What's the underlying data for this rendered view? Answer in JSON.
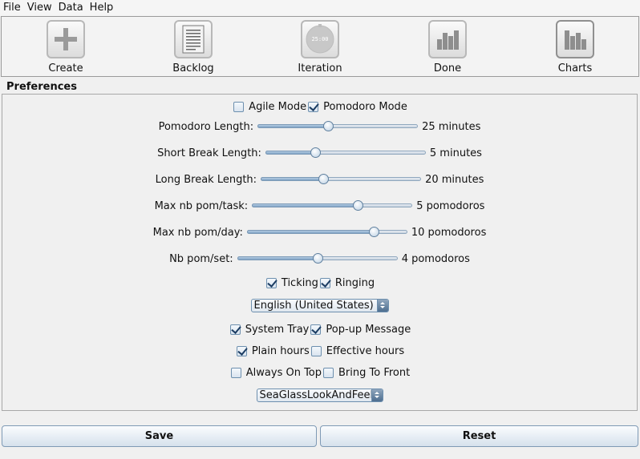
{
  "menu": [
    "File",
    "View",
    "Data",
    "Help"
  ],
  "toolbar": {
    "create": "Create",
    "backlog": "Backlog",
    "iteration": "Iteration",
    "iteration_clock": "25:00",
    "done": "Done",
    "charts": "Charts"
  },
  "preferences": {
    "title": "Preferences",
    "agile_mode": {
      "label": "Agile Mode",
      "checked": false
    },
    "pomodoro_mode": {
      "label": "Pomodoro Mode",
      "checked": true
    },
    "sliders": {
      "pomodoro_length": {
        "label": "Pomodoro Length:",
        "value_text": "25 minutes",
        "fraction": 0.44
      },
      "short_break": {
        "label": "Short Break Length:",
        "value_text": "5 minutes",
        "fraction": 0.31
      },
      "long_break": {
        "label": "Long Break Length:",
        "value_text": "20 minutes",
        "fraction": 0.39
      },
      "max_pom_task": {
        "label": "Max nb pom/task:",
        "value_text": "5 pomodoros",
        "fraction": 0.66
      },
      "max_pom_day": {
        "label": "Max nb pom/day:",
        "value_text": "10 pomodoros",
        "fraction": 0.79
      },
      "pom_set": {
        "label": "Nb pom/set:",
        "value_text": "4 pomodoros",
        "fraction": 0.5
      }
    },
    "ticking": {
      "label": "Ticking",
      "checked": true
    },
    "ringing": {
      "label": "Ringing",
      "checked": true
    },
    "language": "English (United States)",
    "system_tray": {
      "label": "System Tray",
      "checked": true
    },
    "popup_message": {
      "label": "Pop-up Message",
      "checked": true
    },
    "plain_hours": {
      "label": "Plain hours",
      "checked": true
    },
    "effective_hours": {
      "label": "Effective hours",
      "checked": false
    },
    "always_on_top": {
      "label": "Always On Top",
      "checked": false
    },
    "bring_to_front": {
      "label": "Bring To Front",
      "checked": false
    },
    "look_and_feel": "SeaGlassLookAndFeel"
  },
  "buttons": {
    "save": "Save",
    "reset": "Reset"
  }
}
